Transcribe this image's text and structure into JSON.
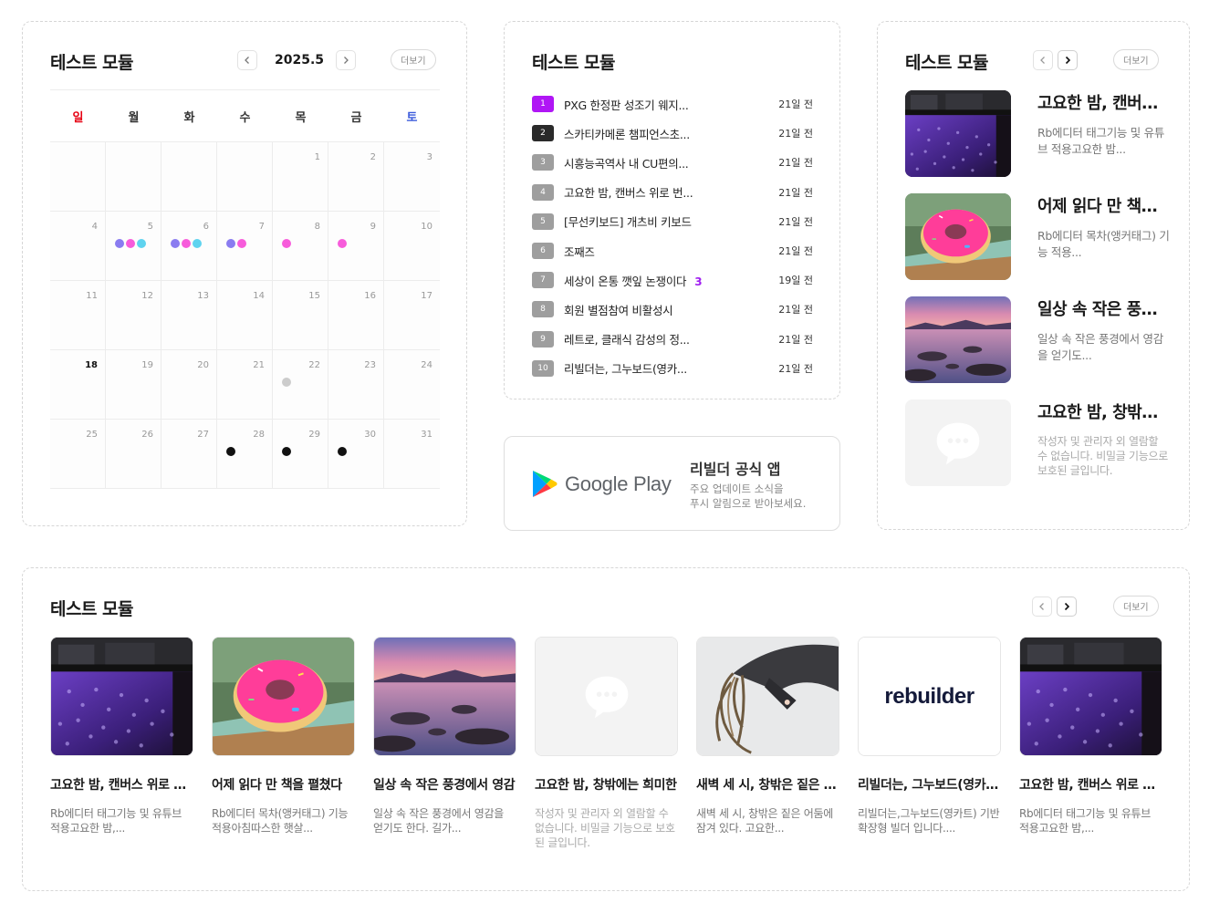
{
  "calendar": {
    "title": "테스트 모듈",
    "month_label": "2025.5",
    "more_label": "더보기",
    "weekdays": [
      "일",
      "월",
      "화",
      "수",
      "목",
      "금",
      "토"
    ],
    "weeks": [
      [
        {
          "d": ""
        },
        {
          "d": ""
        },
        {
          "d": ""
        },
        {
          "d": ""
        },
        {
          "d": "1"
        },
        {
          "d": "2"
        },
        {
          "d": "3"
        }
      ],
      [
        {
          "d": "4"
        },
        {
          "d": "5",
          "dots": [
            "#8a7cf0",
            "#f75cdb",
            "#5fd3ef"
          ]
        },
        {
          "d": "6",
          "dots": [
            "#8a7cf0",
            "#f75cdb",
            "#5fd3ef"
          ]
        },
        {
          "d": "7",
          "dots": [
            "#8a7cf0",
            "#f75cdb"
          ]
        },
        {
          "d": "8",
          "dots": [
            "#f75cdb"
          ]
        },
        {
          "d": "9",
          "dots": [
            "#f75cdb"
          ]
        },
        {
          "d": "10"
        }
      ],
      [
        {
          "d": "11"
        },
        {
          "d": "12"
        },
        {
          "d": "13"
        },
        {
          "d": "14"
        },
        {
          "d": "15"
        },
        {
          "d": "16"
        },
        {
          "d": "17"
        }
      ],
      [
        {
          "d": "18",
          "today": true
        },
        {
          "d": "19"
        },
        {
          "d": "20"
        },
        {
          "d": "21"
        },
        {
          "d": "22",
          "dots": [
            "#cccccc"
          ]
        },
        {
          "d": "23"
        },
        {
          "d": "24"
        }
      ],
      [
        {
          "d": "25"
        },
        {
          "d": "26"
        },
        {
          "d": "27"
        },
        {
          "d": "28",
          "dots": [
            "#111111"
          ]
        },
        {
          "d": "29",
          "dots": [
            "#111111"
          ]
        },
        {
          "d": "30",
          "dots": [
            "#111111"
          ]
        },
        {
          "d": "31"
        }
      ]
    ]
  },
  "ranking": {
    "title": "테스트 모듈",
    "items": [
      {
        "rank": "1",
        "title": "PXG 한정판 성조기 웨지...",
        "time": "21일 전"
      },
      {
        "rank": "2",
        "title": "스카티카메론 챔피언스초...",
        "time": "21일 전"
      },
      {
        "rank": "3",
        "title": "시흥능곡역사 내 CU편의...",
        "time": "21일 전"
      },
      {
        "rank": "4",
        "title": "고요한 밤, 캔버스 위로 번...",
        "time": "21일 전"
      },
      {
        "rank": "5",
        "title": "[무선키보드] 개츠비 키보드",
        "time": "21일 전"
      },
      {
        "rank": "6",
        "title": "조째즈",
        "time": "21일 전"
      },
      {
        "rank": "7",
        "title": "세상이 온통 깻잎 논쟁이다",
        "count": "3",
        "time": "19일 전"
      },
      {
        "rank": "8",
        "title": "회원 별점참여 비활성시",
        "time": "21일 전"
      },
      {
        "rank": "9",
        "title": "레트로, 클래식 감성의 정...",
        "time": "21일 전"
      },
      {
        "rank": "10",
        "title": "리빌더는, 그누보드(영카...",
        "time": "21일 전"
      }
    ]
  },
  "app_banner": {
    "store_label": "Google Play",
    "title": "리빌더 공식 앱",
    "desc_line1": "주요 업데이트 소식을",
    "desc_line2": "푸시 알림으로 받아보세요."
  },
  "side_list": {
    "title": "테스트 모듈",
    "more_label": "더보기",
    "items": [
      {
        "title": "고요한 밤, 캔버스 위로 번지는",
        "desc": "Rb에디터 태그기능 및 유튜브 적용고요한 밤...",
        "image": "rain-window"
      },
      {
        "title": "어제 읽다 만 책을 펼쳤다",
        "desc": "Rb에디터 목차(앵커태그) 기능 적용...",
        "image": "donut"
      },
      {
        "title": "일상 속 작은 풍경에서",
        "desc": "일상 속 작은 풍경에서 영감을 얻기도...",
        "image": "lake-sunset"
      },
      {
        "title": "고요한 밤, 창밖에는 희미한",
        "desc": "작성자 및 관리자 외 열람할 수 없습니다. 비밀글 기능으로 보호된 글입니다.",
        "image": "chat-bubble-icon",
        "locked": true
      }
    ]
  },
  "gallery": {
    "title": "테스트 모듈",
    "more_label": "더보기",
    "cards": [
      {
        "title": "고요한 밤, 캔버스 위로 번지는",
        "desc": "Rb에디터 태그기능 및 유튜브 적용고요한 밤,...",
        "image": "rain-window"
      },
      {
        "title": "어제 읽다 만 책을 펼쳤다",
        "desc": "Rb에디터 목차(앵커태그) 기능 적용아침따스한 햇살...",
        "image": "donut"
      },
      {
        "title": "일상 속 작은 풍경에서 영감",
        "desc": "일상 속 작은 풍경에서 영감을 얻기도 한다. 길가...",
        "image": "lake-sunset"
      },
      {
        "title": "고요한 밤, 창밖에는 희미한",
        "desc": "작성자 및 관리자 외 열람할 수 없습니다. 비밀글 기능으로 보호된 글입니다.",
        "image": "chat-bubble-icon",
        "locked": true
      },
      {
        "title": "새벽 세 시, 창밖은 짙은 어둠",
        "desc": "새벽 세 시, 창밖은 짙은 어둠에 잠겨 있다. 고요한...",
        "image": "hair-photo"
      },
      {
        "title": "리빌더는, 그누보드(영카트)",
        "desc": "리빌더는,그누보드(영카트) 기반 확장형 빌더 입니다....",
        "image": "rebuilder-logo",
        "logo_text": "rebuilder"
      },
      {
        "title": "고요한 밤, 캔버스 위로 번지는",
        "desc": "Rb에디터 태그기능 및 유튜브 적용고요한 밤,...",
        "image": "rain-window"
      }
    ]
  }
}
